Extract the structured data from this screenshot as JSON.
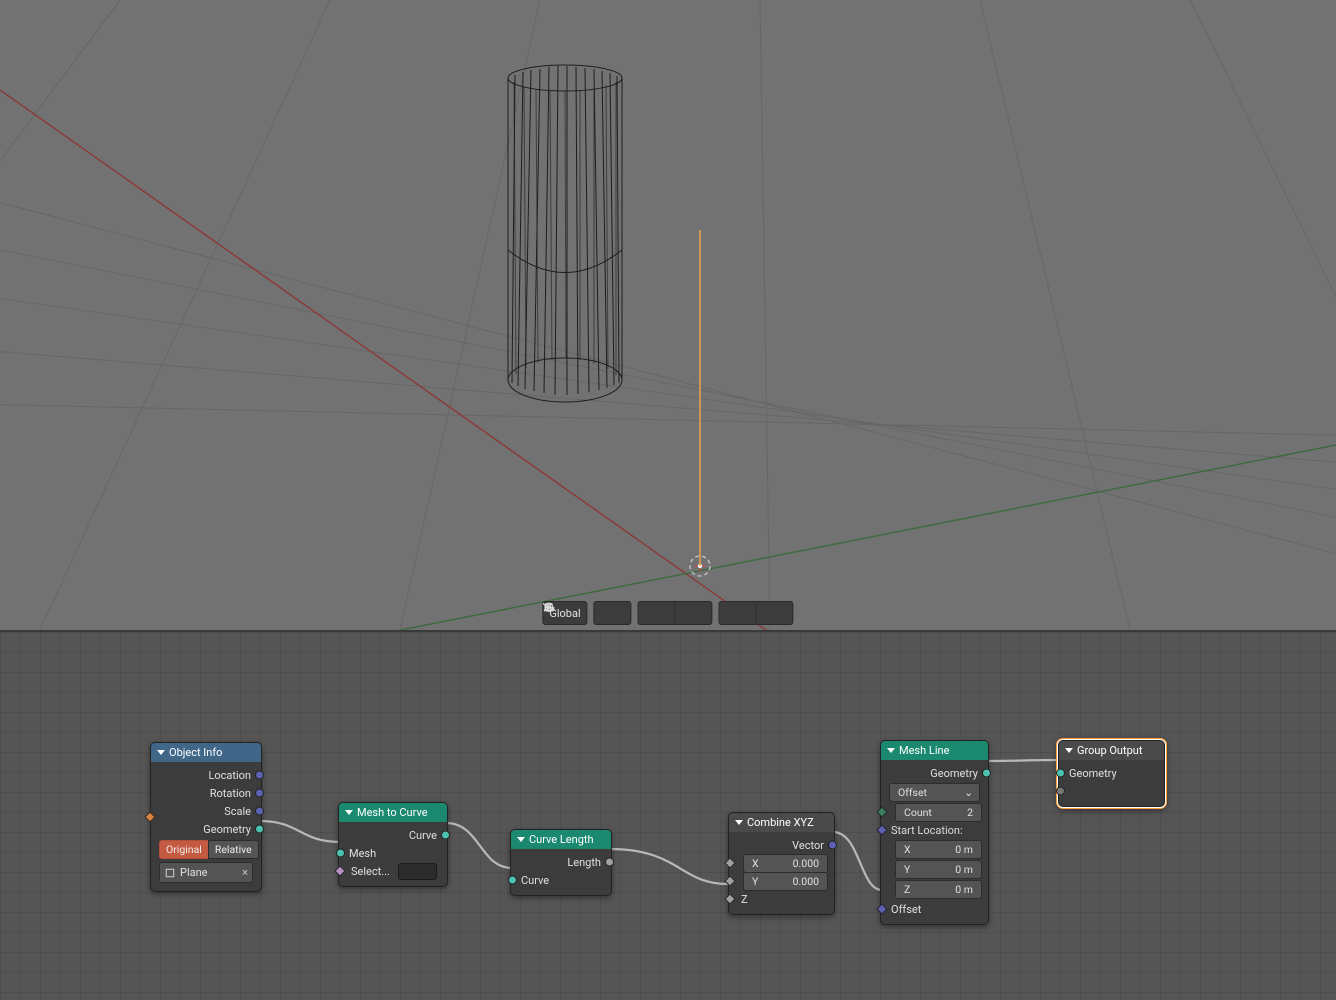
{
  "viewport": {
    "transform_orientation": "Global",
    "icons": [
      "axes-icon",
      "link-icon",
      "magnet-icon",
      "snap-menu-icon",
      "proportional-icon",
      "falloff-icon"
    ]
  },
  "nodes": {
    "object_info": {
      "title": "Object Info",
      "outputs": [
        "Location",
        "Rotation",
        "Scale",
        "Geometry"
      ],
      "modes": [
        "Original",
        "Relative"
      ],
      "object_name": "Plane"
    },
    "mesh_to_curve": {
      "title": "Mesh to Curve",
      "out": "Curve",
      "in_mesh": "Mesh",
      "in_sel": "Select..."
    },
    "curve_length": {
      "title": "Curve Length",
      "out": "Length",
      "in": "Curve"
    },
    "combine_xyz": {
      "title": "Combine XYZ",
      "out": "Vector",
      "x_label": "X",
      "x_val": "0.000",
      "y_label": "Y",
      "y_val": "0.000",
      "z_label": "Z"
    },
    "mesh_line": {
      "title": "Mesh Line",
      "out": "Geometry",
      "mode": "Offset",
      "count_label": "Count",
      "count_val": "2",
      "start_title": "Start Location:",
      "sx_l": "X",
      "sx_v": "0 m",
      "sy_l": "Y",
      "sy_v": "0 m",
      "sz_l": "Z",
      "sz_v": "0 m",
      "offset_label": "Offset"
    },
    "group_output": {
      "title": "Group Output",
      "in": "Geometry"
    }
  }
}
